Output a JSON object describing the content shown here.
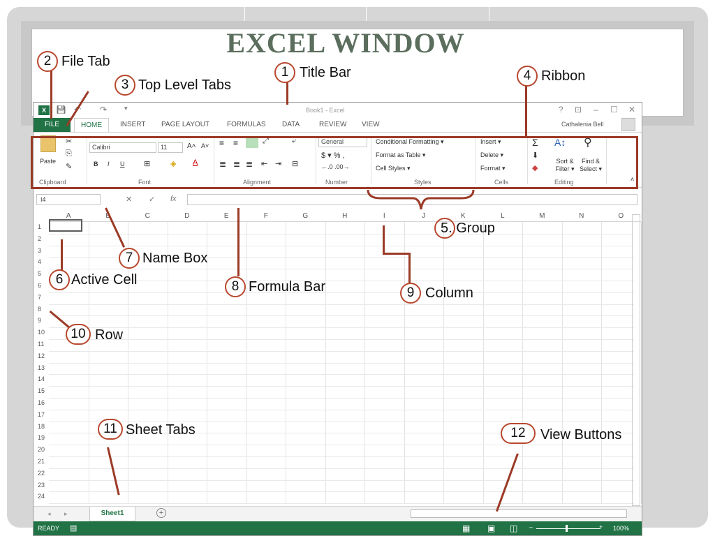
{
  "slide": {
    "title": "EXCEL WINDOW"
  },
  "window": {
    "app_icon": "X",
    "title": "Book1 - Excel",
    "controls": [
      "?",
      "⊡",
      "–",
      "☐",
      "✕"
    ],
    "user": "Cathalenia Bell"
  },
  "tabs": {
    "file": "FILE",
    "home": "HOME",
    "items": [
      "INSERT",
      "PAGE LAYOUT",
      "FORMULAS",
      "DATA",
      "REVIEW",
      "VIEW"
    ]
  },
  "ribbon": {
    "paste": "Paste",
    "font_name": "Calibri",
    "font_size": "11",
    "bold": "B",
    "italic": "I",
    "underline": "U",
    "number_format": "General",
    "currency": "$ ▾ % ,",
    "conditional": "Conditional Formatting ▾",
    "format_table": "Format as Table ▾",
    "cell_styles": "Cell Styles ▾",
    "insert": "Insert ▾",
    "delete": "Delete ▾",
    "format": "Format ▾",
    "sort": "Sort & Filter ▾",
    "find": "Find & Select ▾",
    "groups": [
      "Clipboard",
      "Font",
      "Alignment",
      "Number",
      "Styles",
      "Cells",
      "Editing"
    ]
  },
  "formula_bar": {
    "name_box": "I4",
    "fx": "fx",
    "value": ""
  },
  "columns": [
    "A",
    "B",
    "C",
    "D",
    "E",
    "F",
    "G",
    "H",
    "I",
    "J",
    "K",
    "L",
    "M",
    "N",
    "O"
  ],
  "rows": [
    "1",
    "2",
    "3",
    "4",
    "5",
    "6",
    "7",
    "8",
    "9",
    "10",
    "11",
    "12",
    "13",
    "14",
    "15",
    "16",
    "17",
    "18",
    "19",
    "20",
    "21",
    "22",
    "23",
    "24"
  ],
  "sheet": {
    "tab": "Sheet1",
    "add": "+"
  },
  "status": {
    "ready": "READY",
    "zoom": "100%"
  },
  "annotations": {
    "a1_num": "1",
    "a1_text": "Title Bar",
    "a2_num": "2",
    "a2_text": "File Tab",
    "a3_num": "3",
    "a3_text": "Top Level Tabs",
    "a4_num": "4",
    "a4_text": "Ribbon",
    "a5_text": "5. Group",
    "a6_num": "6",
    "a6_text": "Active Cell",
    "a7_num": "7",
    "a7_text": "Name Box",
    "a8_num": "8",
    "a8_text": "Formula Bar",
    "a9_num": "9",
    "a9_text": "Column",
    "a10_num": "10",
    "a10_text": "Row",
    "a11_num": "11",
    "a11_text": "Sheet Tabs",
    "a12_num": "12",
    "a12_text": "View Buttons"
  },
  "colors": {
    "excel_green": "#217346",
    "annotation": "#9b3a26",
    "title": "#5b6e5d"
  }
}
